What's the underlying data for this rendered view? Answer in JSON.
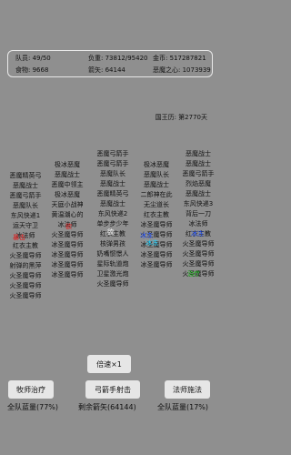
{
  "stats": {
    "members": "队员: 49/50",
    "load": "负重: 73812/95420",
    "gold": "金币: 517287821",
    "food": "食物: 9668",
    "arrows": "箭矢: 64144",
    "demon_heart": "恶魔之心: 1073939"
  },
  "calendar": "国王历: 第2770天",
  "lanes": [
    {
      "name": "lane-1",
      "units": [
        {
          "text": "恶魔精英弓",
          "color": "black"
        },
        {
          "text": "恶魔战士",
          "color": "black"
        },
        {
          "text": "恶魔弓箭手",
          "color": "black"
        },
        {
          "text": "恶魔队长",
          "color": "black"
        },
        {
          "text": "东风快递1",
          "color": "black"
        },
        {
          "text": "运天守卫",
          "color": "black"
        },
        {
          "text": "冰法师",
          "color": "black"
        },
        {
          "text": "红衣主教",
          "color": "black"
        },
        {
          "text": "火圣魔导师",
          "color": "black"
        },
        {
          "text": "射弹的黑萍",
          "color": "black"
        },
        {
          "text": "火圣魔导师",
          "color": "black"
        },
        {
          "text": "火圣魔导师",
          "color": "black"
        },
        {
          "text": "火圣魔导师",
          "color": "black"
        }
      ]
    },
    {
      "name": "lane-2",
      "units": [
        {
          "text": "极冰恶魔",
          "color": "black"
        },
        {
          "text": "恶魔战士",
          "color": "black"
        },
        {
          "text": "恶魔中领主",
          "color": "black"
        },
        {
          "text": "极冰恶魔",
          "color": "black"
        },
        {
          "text": "天庭小战神",
          "color": "black"
        },
        {
          "text": "黄温潮心的",
          "color": "black"
        },
        {
          "text": "冰法师",
          "color": "black"
        },
        {
          "text": "火圣魔导师",
          "color": "black"
        },
        {
          "text": "冰圣魔导师",
          "color": "black"
        },
        {
          "text": "冰圣魔导师",
          "color": "black"
        },
        {
          "text": "冰圣魔导师",
          "color": "black"
        },
        {
          "text": "冰圣魔导师",
          "color": "black"
        }
      ]
    },
    {
      "name": "lane-3",
      "units": [
        {
          "text": "恶魔弓箭手",
          "color": "black"
        },
        {
          "text": "恶魔弓箭手",
          "color": "black"
        },
        {
          "text": "恶魔队长",
          "color": "black"
        },
        {
          "text": "恶魔战士",
          "color": "black"
        },
        {
          "text": "恶魔精英弓",
          "color": "black"
        },
        {
          "text": "恶魔战士",
          "color": "black"
        },
        {
          "text": "东风快递2",
          "color": "black"
        },
        {
          "text": "单步步少年",
          "color": "black"
        },
        {
          "text": "红衣主教",
          "color": "black"
        },
        {
          "text": "核弹男孩",
          "color": "black"
        },
        {
          "text": "奶嘴惯憬人",
          "color": "black"
        },
        {
          "text": "星际轨道炮",
          "color": "black"
        },
        {
          "text": "卫星激光炮",
          "color": "black"
        },
        {
          "text": "火圣魔导师",
          "color": "black"
        }
      ]
    },
    {
      "name": "lane-4",
      "units": [
        {
          "text": "极冰恶魔",
          "color": "black"
        },
        {
          "text": "恶魔队长",
          "color": "black"
        },
        {
          "text": "恶魔战士",
          "color": "black"
        },
        {
          "text": "二郎神在此",
          "color": "black"
        },
        {
          "text": "无尘道长",
          "color": "black"
        },
        {
          "text": "红衣主教",
          "color": "black"
        },
        {
          "text": "冰圣魔导师",
          "color": "black"
        },
        {
          "text": "火圣魔导师",
          "color": "black"
        },
        {
          "text": "冰圣魔导师",
          "color": "black"
        },
        {
          "text": "冰圣魔导师",
          "color": "black"
        },
        {
          "text": "冰圣魔导师",
          "color": "black"
        }
      ]
    },
    {
      "name": "lane-5",
      "units": [
        {
          "text": "恶魔战士",
          "color": "black"
        },
        {
          "text": "恶魔战士",
          "color": "black"
        },
        {
          "text": "恶魔弓箭手",
          "color": "black"
        },
        {
          "text": "烈焰恶魔",
          "color": "black"
        },
        {
          "text": "恶魔战士",
          "color": "black"
        },
        {
          "text": "东风快递3",
          "color": "black"
        },
        {
          "text": "背后一刀",
          "color": "black"
        },
        {
          "text": "冰法师",
          "color": "black"
        },
        {
          "text": "红衣主教",
          "color": "black"
        },
        {
          "text": "火圣魔导师",
          "color": "black"
        },
        {
          "text": "火圣魔导师",
          "color": "black"
        },
        {
          "text": "火圣魔导师",
          "color": "black"
        },
        {
          "text": "火圣魔导师",
          "color": "black"
        }
      ]
    }
  ],
  "effects": [
    {
      "text": "欲",
      "color": "#e01818"
    },
    {
      "text": "欲",
      "color": "#ffffff"
    },
    {
      "text": "冰冻",
      "color": "#2a58ff"
    },
    {
      "text": "冰冻",
      "color": "#1ad0ff"
    },
    {
      "text": "暴击",
      "color": "#e01818"
    },
    {
      "text": "冰冻",
      "color": "#2a58ff"
    },
    {
      "text": "治疗",
      "color": "#18c018"
    }
  ],
  "controls": {
    "speed_label": "倍速×1",
    "priest_label": "牧师治疗",
    "archer_label": "弓箭手射击",
    "mage_label": "法师施法",
    "priest_status": "全队蓝量(77%)",
    "archer_status": "剩余箭矢(64144)",
    "mage_status": "全队蓝量(17%)"
  }
}
